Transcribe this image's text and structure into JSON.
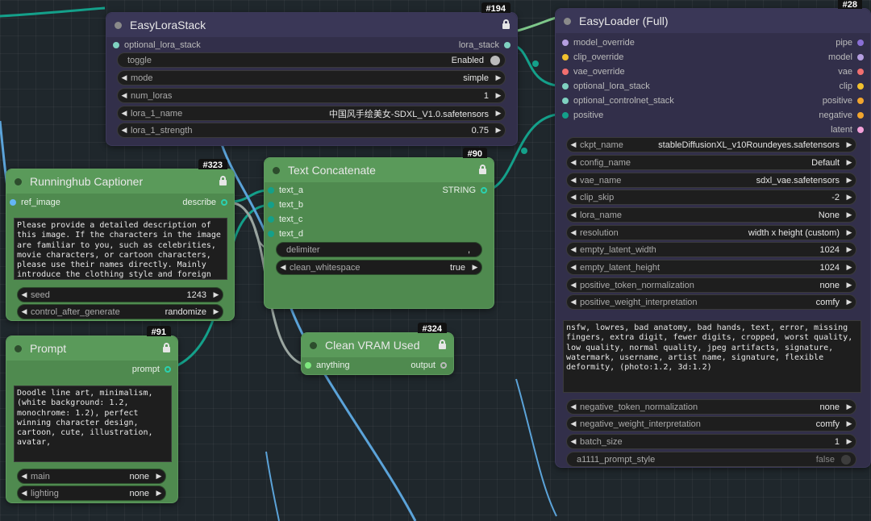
{
  "colors": {
    "wire_blue": "#5ba3d9",
    "wire_teal": "#14a08a",
    "wire_gray": "#9aa5a0",
    "wire_green": "#7ec88a"
  },
  "lora_stack": {
    "title": "EasyLoraStack",
    "badge": "#194",
    "input": "optional_lora_stack",
    "output": "lora_stack",
    "widgets": [
      {
        "label": "toggle",
        "value": "Enabled"
      },
      {
        "label": "mode",
        "value": "simple"
      },
      {
        "label": "num_loras",
        "value": "1"
      },
      {
        "label": "lora_1_name",
        "value": "中国风手绘美女-SDXL_V1.0.safetensors"
      },
      {
        "label": "lora_1_strength",
        "value": "0.75"
      }
    ]
  },
  "loader": {
    "title": "EasyLoader (Full)",
    "badge": "#28",
    "inputs": [
      "model_override",
      "clip_override",
      "vae_override",
      "optional_lora_stack",
      "optional_controlnet_stack",
      "positive"
    ],
    "outputs": [
      "pipe",
      "model",
      "vae",
      "clip",
      "positive",
      "negative",
      "latent"
    ],
    "widgets_top": [
      {
        "label": "ckpt_name",
        "value": "stableDiffusionXL_v10Roundeyes.safetensors"
      },
      {
        "label": "config_name",
        "value": "Default"
      },
      {
        "label": "vae_name",
        "value": "sdxl_vae.safetensors"
      },
      {
        "label": "clip_skip",
        "value": "-2"
      },
      {
        "label": "lora_name",
        "value": "None"
      },
      {
        "label": "resolution",
        "value": "width x height (custom)"
      },
      {
        "label": "empty_latent_width",
        "value": "1024"
      },
      {
        "label": "empty_latent_height",
        "value": "1024"
      },
      {
        "label": "positive_token_normalization",
        "value": "none"
      },
      {
        "label": "positive_weight_interpretation",
        "value": "comfy"
      }
    ],
    "negative_text": "nsfw, lowres, bad anatomy, bad hands, text, error, missing fingers, extra digit, fewer digits, cropped, worst quality, low quality, normal quality, jpeg artifacts, signature, watermark, username, artist name, signature, flexible deformity, (photo:1.2, 3d:1.2)",
    "widgets_bottom": [
      {
        "label": "negative_token_normalization",
        "value": "none"
      },
      {
        "label": "negative_weight_interpretation",
        "value": "comfy"
      },
      {
        "label": "batch_size",
        "value": "1"
      }
    ],
    "toggle": {
      "label": "a1111_prompt_style",
      "value": "false"
    }
  },
  "captioner": {
    "title": "Runninghub Captioner",
    "badge": "#323",
    "input": "ref_image",
    "output": "describe",
    "text": "Please provide a detailed description of this image. If the characters in the image are familiar to you, such as celebrities, movie characters, or cartoon characters, please use their names directly. Mainly introduce the clothing style and foreign",
    "widgets": [
      {
        "label": "seed",
        "value": "1243"
      },
      {
        "label": "control_after_generate",
        "value": "randomize"
      }
    ]
  },
  "concat": {
    "title": "Text Concatenate",
    "badge": "#90",
    "inputs": [
      "text_a",
      "text_b",
      "text_c",
      "text_d"
    ],
    "output": "STRING",
    "delimiter_label": "delimiter",
    "delimiter_value": ",",
    "widget": {
      "label": "clean_whitespace",
      "value": "true"
    }
  },
  "prompt": {
    "title": "Prompt",
    "badge": "#91",
    "output": "prompt",
    "text": "Doodle line art, minimalism, (white background: 1.2, monochrome: 1.2), perfect winning character design, cartoon, cute, illustration, avatar,",
    "widgets": [
      {
        "label": "main",
        "value": "none"
      },
      {
        "label": "lighting",
        "value": "none"
      }
    ]
  },
  "vram": {
    "title": "Clean VRAM Used",
    "badge": "#324",
    "input": "anything",
    "output": "output"
  }
}
